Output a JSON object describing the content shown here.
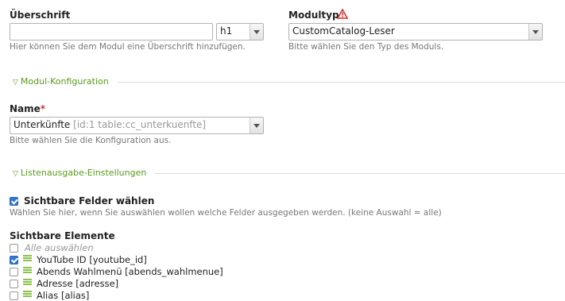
{
  "headline": {
    "label": "Überschrift",
    "value": "",
    "level": "h1",
    "hint": "Hier können Sie dem Modul eine Überschrift hinzufügen."
  },
  "module_type": {
    "label": "Modultyp",
    "value": "CustomCatalog-Leser",
    "hint": "Bitte wählen Sie den Typ des Moduls."
  },
  "config_section": {
    "legend": "Modul-Konfiguration",
    "name_label": "Name",
    "required_mark": "*",
    "name_value": "Unterkünfte",
    "name_meta": "[id:1 table:cc_unterkuenfte]",
    "hint": "Bitte wählen Sie die Konfiguration aus."
  },
  "list_section": {
    "legend": "Listenausgabe-Einstellungen",
    "visible_fields_label": "Sichtbare Felder wählen",
    "visible_fields_hint": "Wählen Sie hier, wenn Sie auswählen wollen welche Felder ausgegeben werden. (keine Auswahl = alle)",
    "visible_elements_label": "Sichtbare Elemente",
    "select_all": "Alle auswählen",
    "items": [
      {
        "label": "YouTube ID [youtube_id]",
        "checked": true
      },
      {
        "label": "Abends Wahlmenü [abends_wahlmenue]",
        "checked": false
      },
      {
        "label": "Adresse [adresse]",
        "checked": false
      },
      {
        "label": "Alias [alias]",
        "checked": false
      }
    ]
  }
}
